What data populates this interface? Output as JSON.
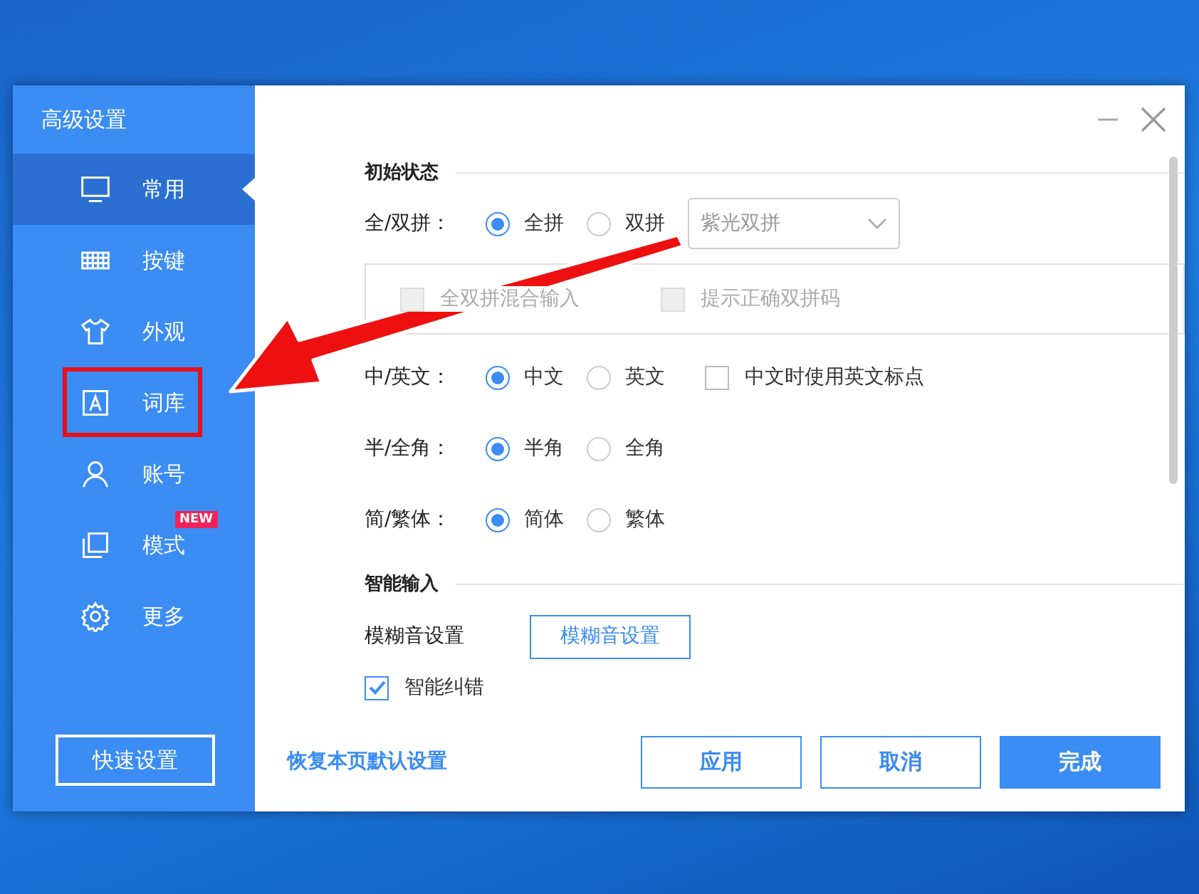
{
  "sidebar": {
    "title": "高级设置",
    "items": [
      {
        "label": "常用",
        "selected": true,
        "highlighted": false
      },
      {
        "label": "按键",
        "selected": false,
        "highlighted": false
      },
      {
        "label": "外观",
        "selected": false,
        "highlighted": false
      },
      {
        "label": "词库",
        "selected": false,
        "highlighted": true
      },
      {
        "label": "账号",
        "selected": false,
        "highlighted": false
      },
      {
        "label": "模式",
        "selected": false,
        "highlighted": false,
        "badge": "NEW"
      },
      {
        "label": "更多",
        "selected": false,
        "highlighted": false
      }
    ],
    "quick_button": "快速设置"
  },
  "content": [
    {
      "kind": "section",
      "title": "初始状态"
    },
    {
      "kind": "radio",
      "label": "全/双拼：",
      "options": [
        {
          "label": "全拼",
          "selected": true
        },
        {
          "label": "双拼",
          "selected": false
        }
      ],
      "dropdown": {
        "value": "紫光双拼"
      }
    },
    {
      "kind": "subbox",
      "checkboxes": [
        {
          "label": "全双拼混合输入",
          "checked": false,
          "disabled": true
        },
        {
          "label": "提示正确双拼码",
          "checked": false,
          "disabled": true
        }
      ]
    },
    {
      "kind": "radio",
      "label": "中/英文：",
      "options": [
        {
          "label": "中文",
          "selected": true
        },
        {
          "label": "英文",
          "selected": false
        }
      ],
      "checkbox": {
        "label": "中文时使用英文标点",
        "checked": false,
        "disabled": false
      }
    },
    {
      "kind": "radio",
      "label": "半/全角：",
      "options": [
        {
          "label": "半角",
          "selected": true
        },
        {
          "label": "全角",
          "selected": false
        }
      ]
    },
    {
      "kind": "radio",
      "label": "简/繁体：",
      "options": [
        {
          "label": "简体",
          "selected": true
        },
        {
          "label": "繁体",
          "selected": false
        }
      ]
    },
    {
      "kind": "section",
      "title": "智能输入"
    },
    {
      "kind": "fuzzy",
      "label": "模糊音设置",
      "button": "模糊音设置"
    },
    {
      "kind": "check",
      "label": "智能纠错",
      "checked": true,
      "disabled": false
    }
  ],
  "footer": {
    "restore_link": "恢复本页默认设置",
    "buttons": [
      {
        "label": "应用",
        "primary": false
      },
      {
        "label": "取消",
        "primary": false
      },
      {
        "label": "完成",
        "primary": true
      }
    ]
  }
}
